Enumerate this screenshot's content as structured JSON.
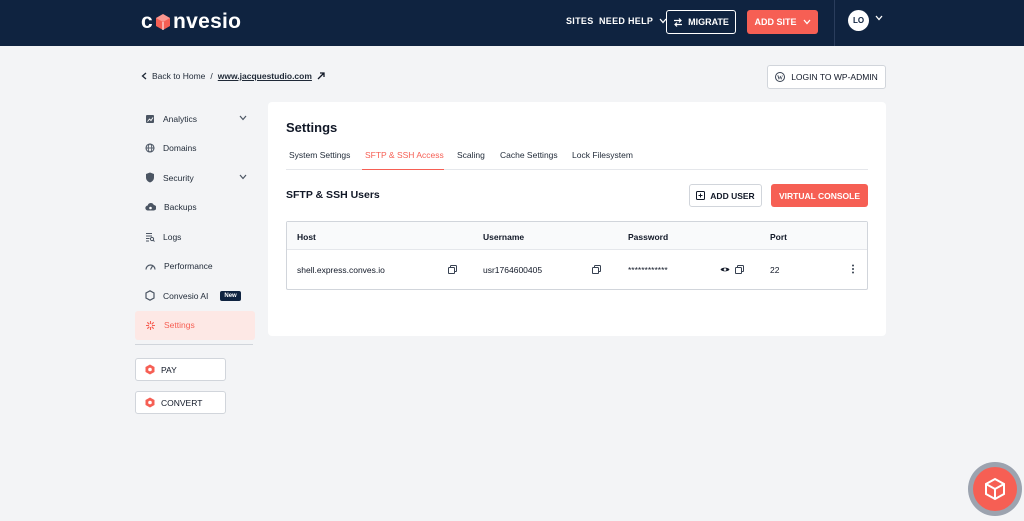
{
  "header": {
    "logo_text": "convesio",
    "nav_sites": "SITES",
    "nav_help": "NEED HELP",
    "migrate_label": "MIGRATE",
    "add_site_label": "ADD SITE",
    "avatar_initials": "LO"
  },
  "breadcrumb": {
    "back_label": "Back to Home",
    "separator": "/",
    "site": "www.jacquestudio.com"
  },
  "wp_admin_label": "LOGIN TO WP-ADMIN",
  "sidebar": {
    "items": [
      {
        "label": "Analytics",
        "icon": "analytics-icon"
      },
      {
        "label": "Domains",
        "icon": "globe-icon"
      },
      {
        "label": "Security",
        "icon": "shield-icon"
      },
      {
        "label": "Backups",
        "icon": "backup-icon"
      },
      {
        "label": "Logs",
        "icon": "logs-icon"
      },
      {
        "label": "Performance",
        "icon": "gauge-icon"
      },
      {
        "label": "Convesio AI",
        "icon": "hexagon-icon",
        "badge": "New"
      },
      {
        "label": "Settings",
        "icon": "settings-icon",
        "active": true
      }
    ],
    "pay_label": "PAY",
    "convert_label": "CONVERT"
  },
  "main": {
    "title": "Settings",
    "tabs": [
      {
        "label": "System Settings"
      },
      {
        "label": "SFTP & SSH Access",
        "active": true
      },
      {
        "label": "Scaling"
      },
      {
        "label": "Cache Settings"
      },
      {
        "label": "Lock Filesystem"
      }
    ],
    "section_title": "SFTP & SSH Users",
    "add_user_label": "ADD USER",
    "virtual_console_label": "VIRTUAL CONSOLE",
    "table": {
      "columns": [
        "Host",
        "Username",
        "Password",
        "Port"
      ],
      "rows": [
        {
          "host": "shell.express.conves.io",
          "username": "usr1764600405",
          "password": "************",
          "port": "22"
        }
      ]
    }
  },
  "colors": {
    "navy": "#0f2340",
    "accent": "#f65f54",
    "background": "#f3f4f6"
  }
}
